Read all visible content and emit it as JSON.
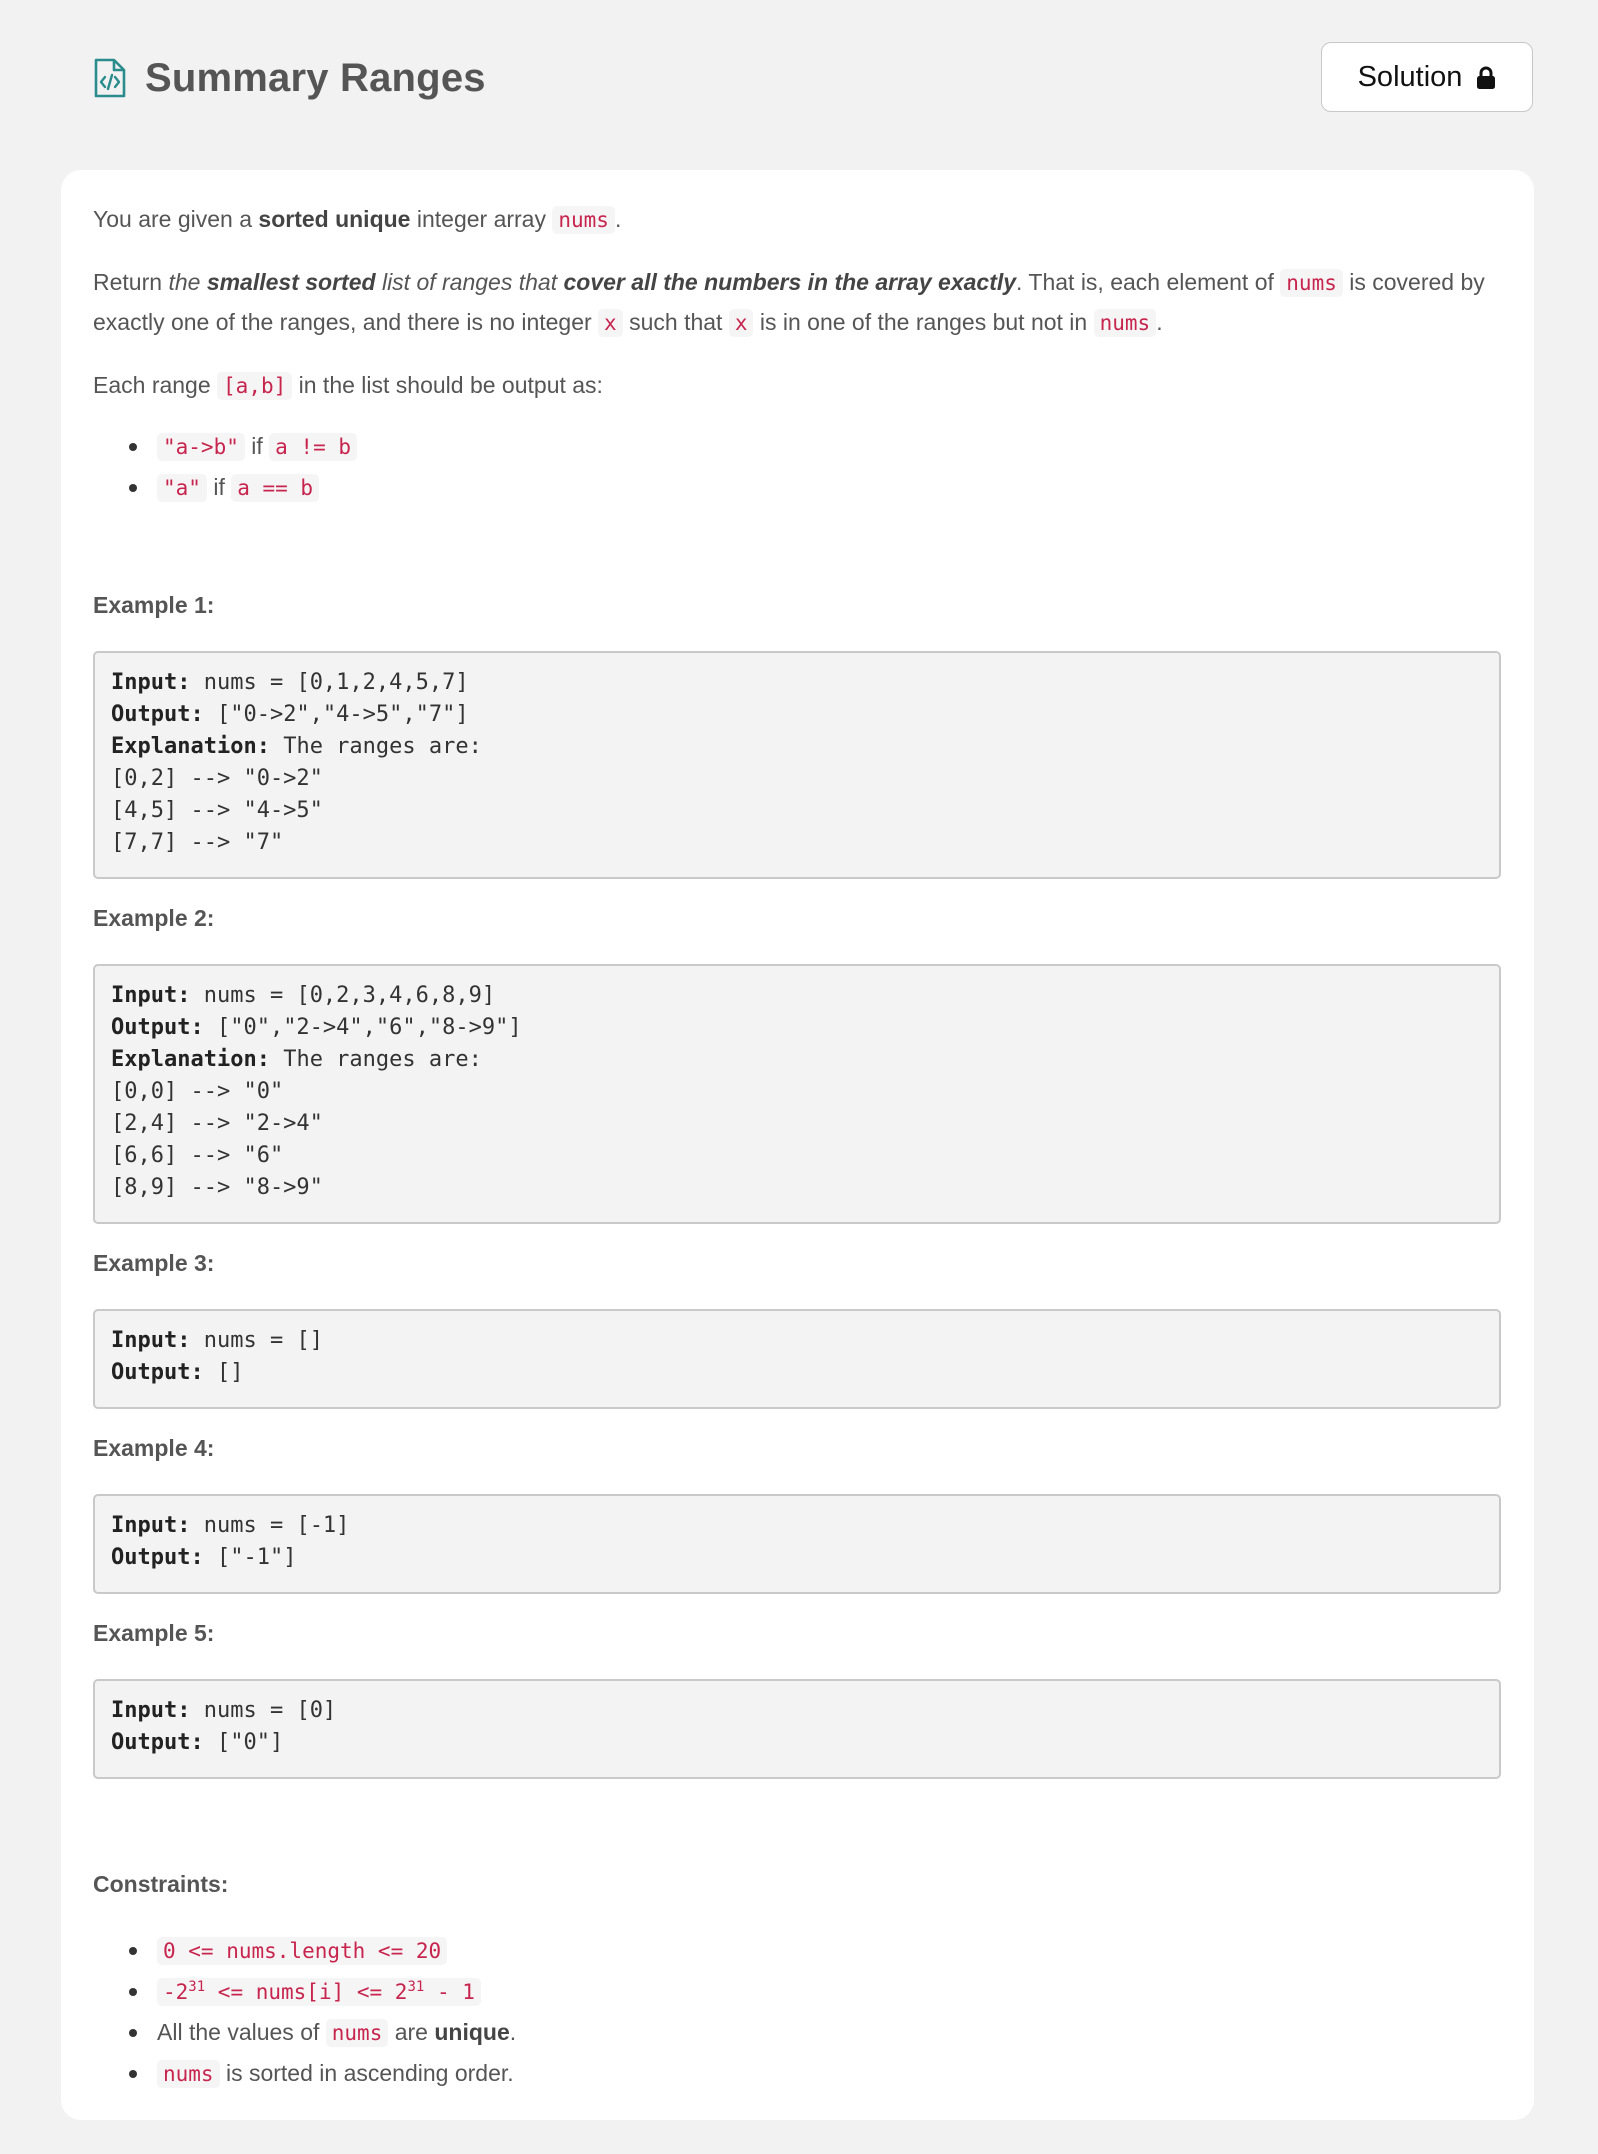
{
  "page": {
    "title": "Summary Ranges",
    "solution_label": "Solution",
    "icons": {
      "title": "code-file-icon",
      "solution": "lock-icon"
    },
    "colors": {
      "code_text": "#c7254e",
      "icon_teal": "#2a8c8c"
    }
  },
  "description": {
    "p1": [
      "You are given a ",
      "sorted unique",
      " integer array ",
      "nums",
      "."
    ],
    "p2": [
      "Return ",
      "the ",
      "smallest sorted",
      " list of ranges that ",
      "cover all the numbers in the array exactly",
      ". That is, each element of ",
      "nums",
      " is covered by exactly one of the ranges, and there is no integer ",
      "x",
      " such that ",
      "x",
      " is in one of the ranges but not in ",
      "nums",
      "."
    ],
    "p3": [
      "Each range ",
      "[a,b]",
      " in the list should be output as:"
    ],
    "formats": [
      {
        "output": "\"a->b\"",
        "word": " if ",
        "condition": "a != b"
      },
      {
        "output": "\"a\"",
        "word": " if ",
        "condition": "a == b"
      }
    ]
  },
  "labels": {
    "input": "Input:",
    "output": "Output:",
    "explanation": "Explanation:"
  },
  "examples": [
    {
      "label": "Example 1:",
      "input": " nums = [0,1,2,4,5,7]",
      "output": " [\"0->2\",\"4->5\",\"7\"]",
      "explanation": " The ranges are:",
      "lines": [
        "[0,2] --> \"0->2\"",
        "[4,5] --> \"4->5\"",
        "[7,7] --> \"7\""
      ]
    },
    {
      "label": "Example 2:",
      "input": " nums = [0,2,3,4,6,8,9]",
      "output": " [\"0\",\"2->4\",\"6\",\"8->9\"]",
      "explanation": " The ranges are:",
      "lines": [
        "[0,0] --> \"0\"",
        "[2,4] --> \"2->4\"",
        "[6,6] --> \"6\"",
        "[8,9] --> \"8->9\""
      ]
    },
    {
      "label": "Example 3:",
      "input": " nums = []",
      "output": " []"
    },
    {
      "label": "Example 4:",
      "input": " nums = [-1]",
      "output": " [\"-1\"]"
    },
    {
      "label": "Example 5:",
      "input": " nums = [0]",
      "output": " [\"0\"]"
    }
  ],
  "constraints": {
    "label": "Constraints:",
    "c1": "0 <= nums.length <= 20",
    "c2": [
      "-2",
      "31",
      " <= nums[i] <= 2",
      "31",
      " - 1"
    ],
    "c3": [
      "All the values of ",
      "nums",
      " are ",
      "unique",
      "."
    ],
    "c4": [
      "nums",
      " is sorted in ascending order."
    ]
  }
}
